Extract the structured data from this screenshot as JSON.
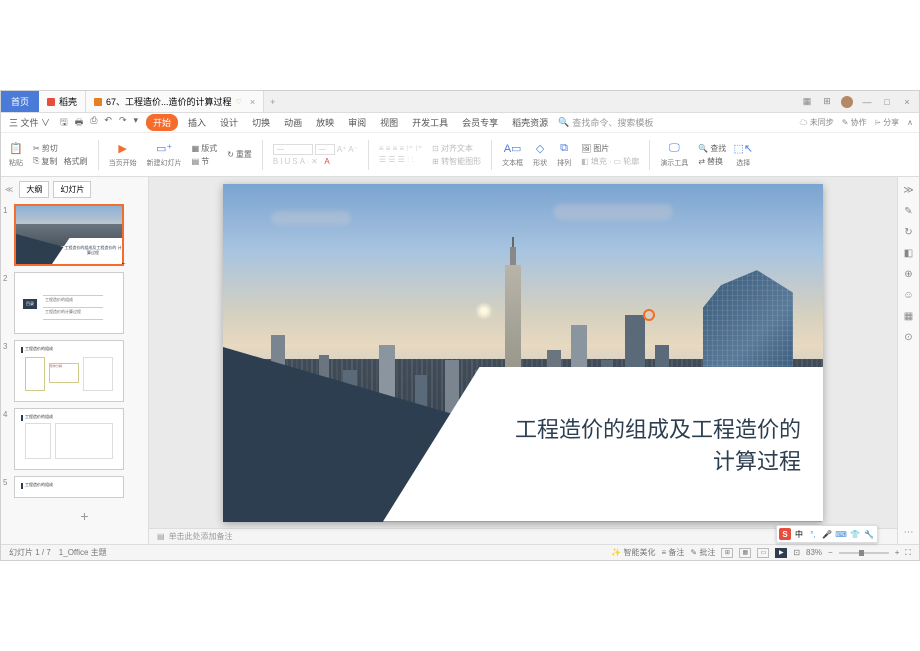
{
  "tabs": {
    "home": "首页",
    "doc1": "稻壳",
    "doc2": "67、工程造价...造价的计算过程",
    "add": "+"
  },
  "win": {
    "min": "—",
    "max": "□",
    "close": "×"
  },
  "menu_left": {
    "file": "三 文件 ∨"
  },
  "menu": {
    "start": "开始",
    "insert": "插入",
    "design": "设计",
    "trans": "切换",
    "anim": "动画",
    "show": "放映",
    "review": "审阅",
    "view": "视图",
    "dev": "开发工具",
    "member": "会员专享",
    "res": "稻壳资源"
  },
  "menu_right": {
    "search_icon": "🔍",
    "search_ph": "查找命令、搜索模板",
    "sync": "未同步",
    "coop": "协作",
    "share": "分享"
  },
  "ribbon": {
    "paste": "粘贴",
    "cut": "剪切",
    "copy": "复制",
    "format_painter": "格式刷",
    "from_current": "当页开始",
    "new_slide": "新建幻灯片",
    "layout": "版式",
    "section": "节",
    "reset": "重置",
    "font_ph": "—",
    "size_ph": "—",
    "align_text": "对齐文本",
    "text_box": "文本框",
    "shape": "形状",
    "arrange": "排列",
    "image": "图片",
    "tools": "演示工具",
    "find": "查找",
    "replace": "替换",
    "select": "选择"
  },
  "sidepanel": {
    "outline": "大纲",
    "slides": "幻灯片"
  },
  "thumbs": {
    "t1_text": "工程造价的组成及工程造价的\n计算过程",
    "t2_tag": "目录",
    "t2_l1": "工程造价的组成",
    "t2_l2": "工程造价的计算过程",
    "t3_title": "工程造价的组成",
    "t4_title": "工程造价的组成",
    "t5_title": "工程造价的组成"
  },
  "slide": {
    "title_l1": "工程造价的组成及工程造价的",
    "title_l2": "计算过程"
  },
  "notes": {
    "placeholder": "单击此处添加备注"
  },
  "status": {
    "slide_pos": "幻灯片 1 / 7",
    "theme": "1_Office 主题",
    "smart_beautify": "智能美化",
    "notes_btn": "备注",
    "comments_btn": "批注",
    "zoom": "83%"
  },
  "ime": {
    "s": "S",
    "zhong": "中"
  }
}
